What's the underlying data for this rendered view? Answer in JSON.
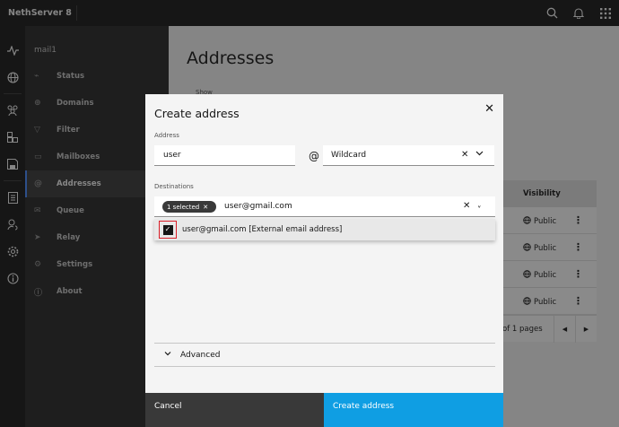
{
  "app": {
    "title": "NethServer 8"
  },
  "topbar": {
    "icons": [
      "search-icon",
      "notification-icon",
      "app-switcher-icon"
    ]
  },
  "rail": {
    "icons": [
      "activity-icon",
      "network-icon",
      "users-icon",
      "apps-icon",
      "save-icon",
      "logs-icon",
      "sync-icon",
      "settings-icon",
      "info-icon"
    ]
  },
  "sidebar": {
    "title": "mail1",
    "items": [
      {
        "label": "Status",
        "icon": "activity-icon",
        "glyph": "⌁",
        "active": false
      },
      {
        "label": "Domains",
        "icon": "globe-icon",
        "glyph": "⊕",
        "active": false
      },
      {
        "label": "Filter",
        "icon": "filter-icon",
        "glyph": "▽",
        "active": false
      },
      {
        "label": "Mailboxes",
        "icon": "mailbox-icon",
        "glyph": "▭",
        "active": false
      },
      {
        "label": "Addresses",
        "icon": "at-icon",
        "glyph": "@",
        "active": true
      },
      {
        "label": "Queue",
        "icon": "mail-icon",
        "glyph": "✉",
        "active": false
      },
      {
        "label": "Relay",
        "icon": "send-icon",
        "glyph": "➤",
        "active": false
      },
      {
        "label": "Settings",
        "icon": "gear-icon",
        "glyph": "⚙",
        "active": false
      },
      {
        "label": "About",
        "icon": "info-icon",
        "glyph": "ⓘ",
        "active": false
      }
    ]
  },
  "main": {
    "title": "Addresses",
    "show_label": "Show",
    "table": {
      "visibility_header": "Visibility",
      "rows": [
        "Public",
        "Public",
        "Public",
        "Public"
      ],
      "pagination_text": "of 1 pages"
    }
  },
  "modal": {
    "title": "Create address",
    "address_label": "Address",
    "address_value": "user",
    "at_symbol": "@",
    "domain_value": "Wildcard",
    "destinations_label": "Destinations",
    "selected_pill": "1 selected",
    "destinations_query": "user@gmail.com",
    "option_text": "user@gmail.com [External email address]",
    "advanced_label": "Advanced",
    "cancel_label": "Cancel",
    "create_label": "Create address"
  },
  "colors": {
    "accent": "#0f9ee3",
    "topbar": "#161616",
    "sidebar": "#262626",
    "active_border": "#4589ff",
    "highlight": "#da1e28"
  }
}
